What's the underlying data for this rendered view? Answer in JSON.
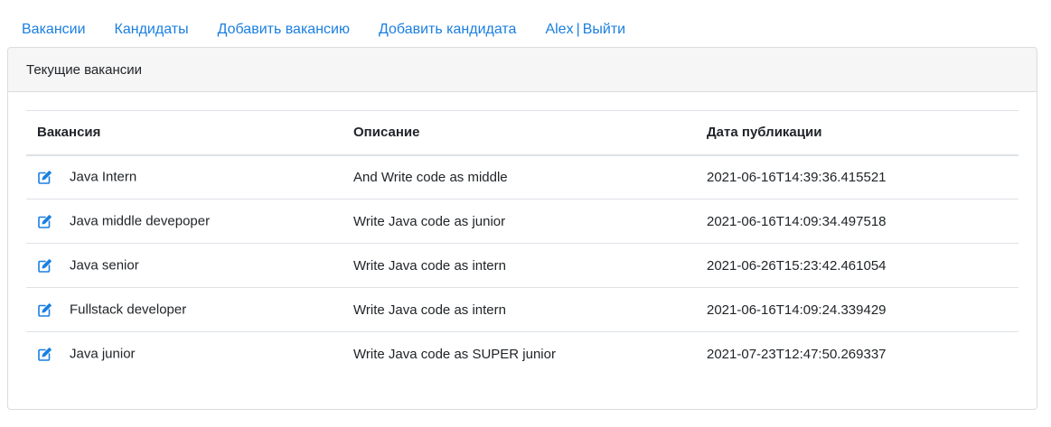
{
  "nav": {
    "vacancies": "Вакансии",
    "candidates": "Кандидаты",
    "add_vacancy": "Добавить вакансию",
    "add_candidate": "Добавить кандидата",
    "user": "Alex",
    "separator": "|",
    "logout": "Выйти"
  },
  "card": {
    "header": "Текущие вакансии"
  },
  "table": {
    "columns": [
      "Вакансия",
      "Описание",
      "Дата публикации"
    ],
    "rows": [
      {
        "icon": "edit-icon",
        "name": "Java Intern",
        "description": "And Write code as middle",
        "date": "2021-06-16T14:39:36.415521"
      },
      {
        "icon": "edit-icon",
        "name": "Java middle devepoper",
        "description": "Write Java code as junior",
        "date": "2021-06-16T14:09:34.497518"
      },
      {
        "icon": "edit-icon",
        "name": "Java senior",
        "description": "Write Java code as intern",
        "date": "2021-06-26T15:23:42.461054"
      },
      {
        "icon": "edit-icon",
        "name": "Fullstack developer",
        "description": "Write Java code as intern",
        "date": "2021-06-16T14:09:24.339429"
      },
      {
        "icon": "edit-icon",
        "name": "Java junior",
        "description": "Write Java code as SUPER junior",
        "date": "2021-07-23T12:47:50.269337"
      }
    ]
  },
  "colors": {
    "link": "#1a7fe0",
    "header_bg": "#f6f6f6",
    "border": "#dee2e6"
  }
}
